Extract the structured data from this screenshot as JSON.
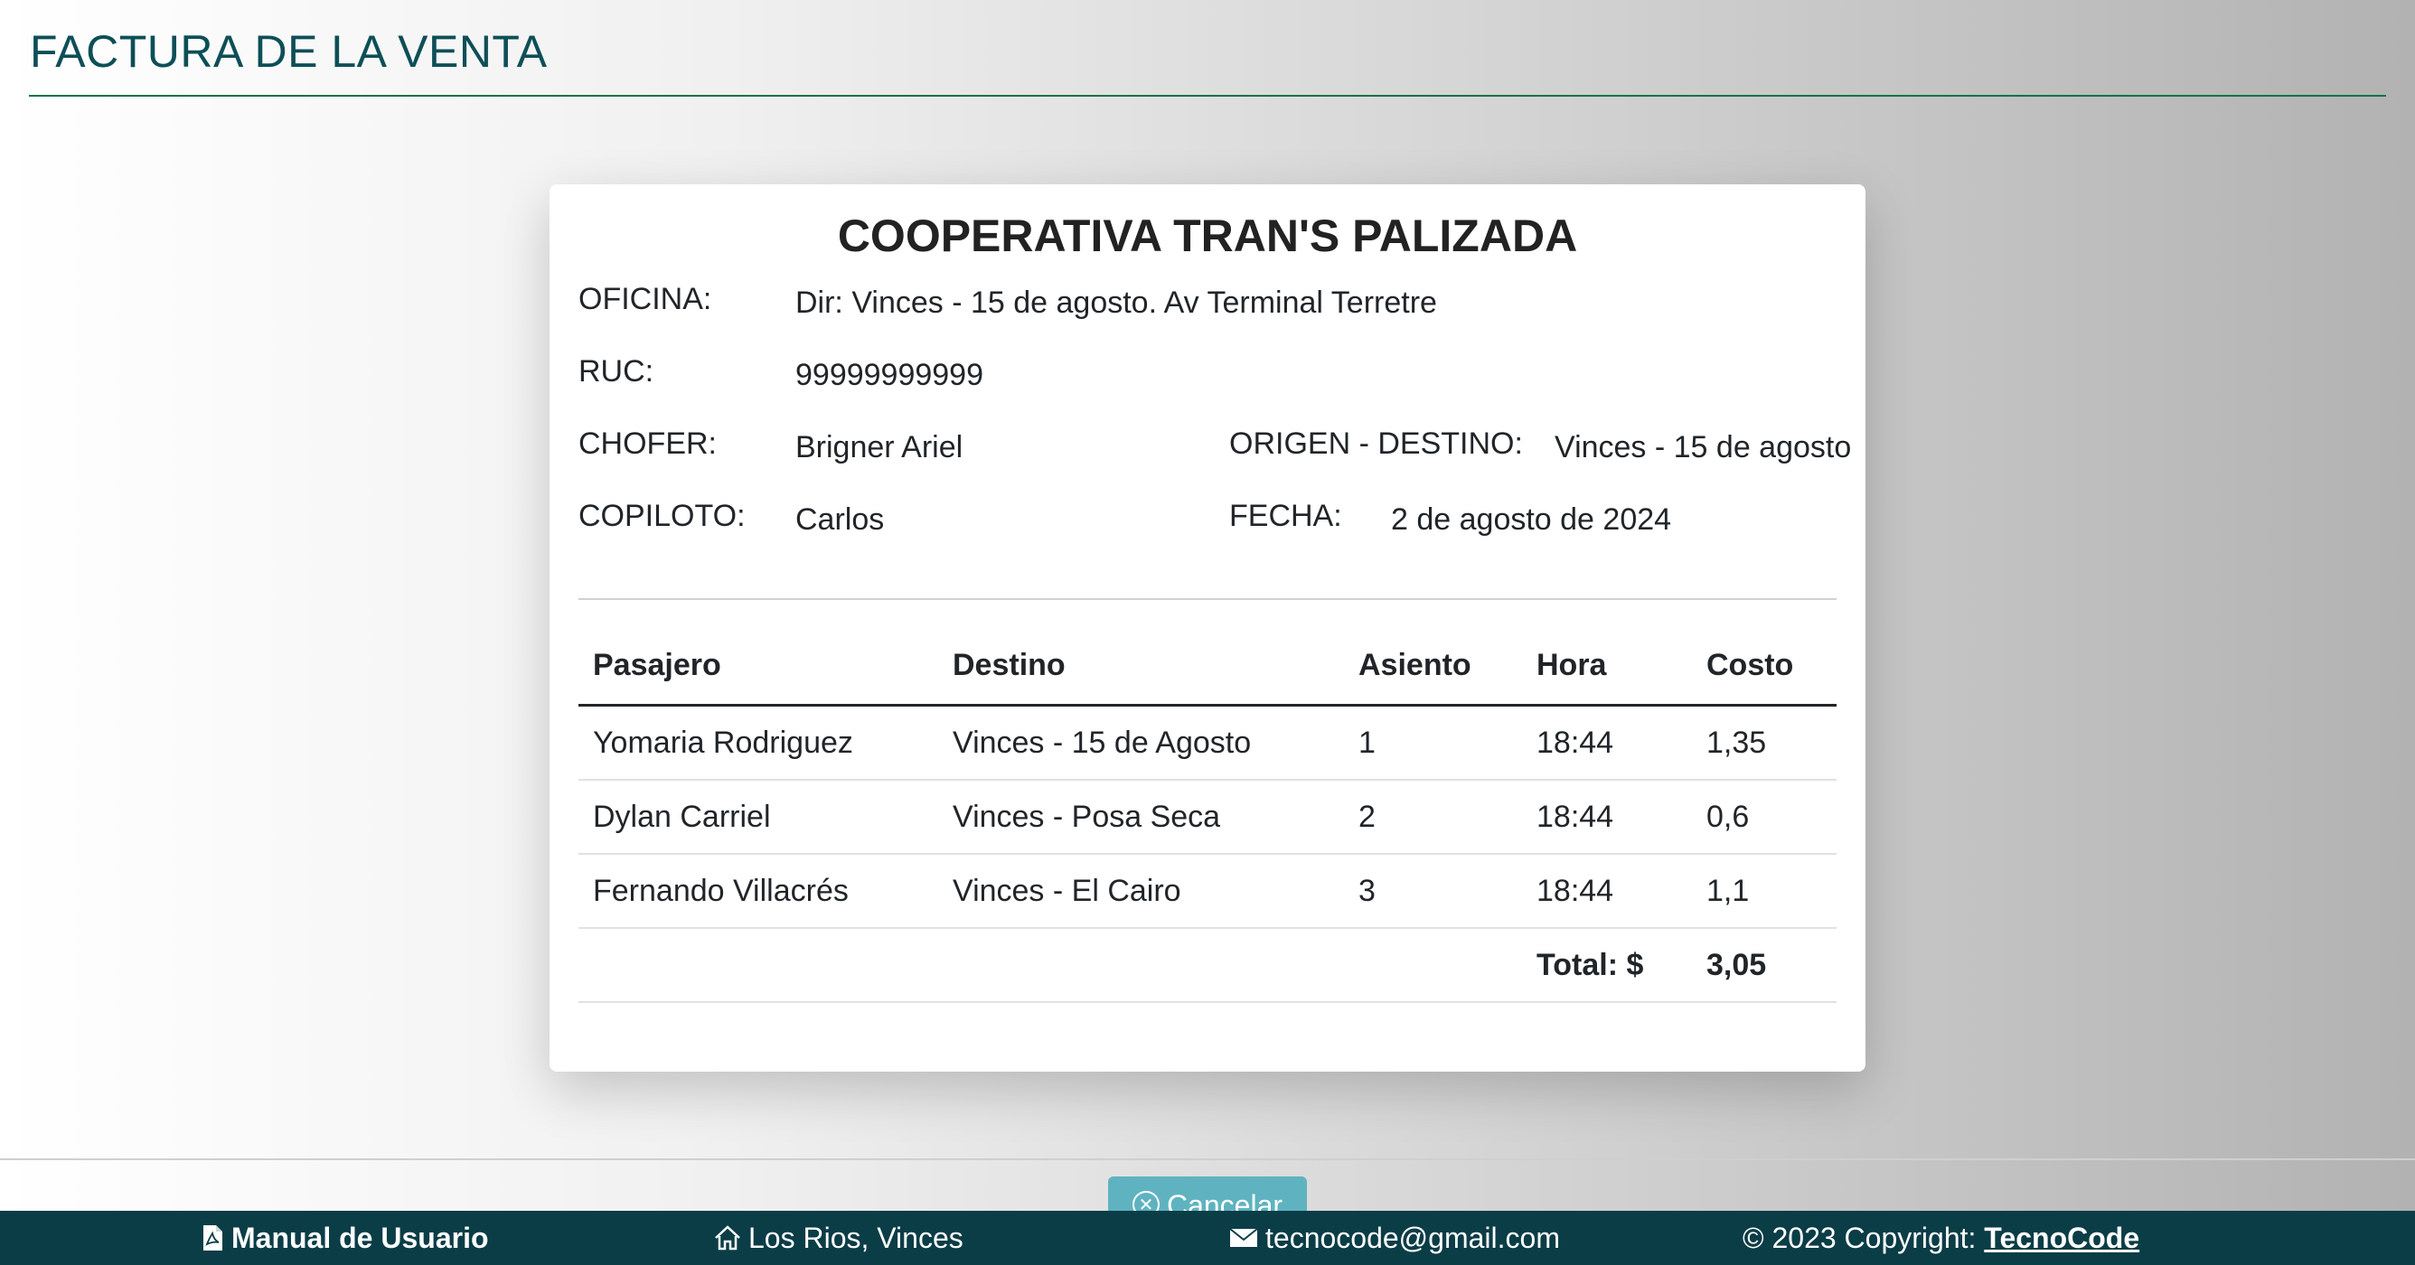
{
  "page": {
    "title": "FACTURA DE LA VENTA"
  },
  "invoice": {
    "company": "COOPERATIVA TRAN'S PALIZADA",
    "oficina_label": "OFICINA:",
    "oficina_value": "Dir: Vinces - 15 de agosto. Av Terminal Terretre",
    "ruc_label": "RUC:",
    "ruc_value": "99999999999",
    "chofer_label": "CHOFER:",
    "chofer_value": "Brigner Ariel",
    "origen_label": "ORIGEN - DESTINO:",
    "origen_value": "Vinces - 15 de agosto",
    "copiloto_label": "COPILOTO:",
    "copiloto_value": "Carlos",
    "fecha_label": "FECHA:",
    "fecha_value": "2 de agosto de 2024"
  },
  "table": {
    "headers": [
      "Pasajero",
      "Destino",
      "Asiento",
      "Hora",
      "Costo"
    ],
    "rows": [
      [
        "Yomaria Rodriguez",
        "Vinces - 15 de Agosto",
        "1",
        "18:44",
        "1,35"
      ],
      [
        "Dylan Carriel",
        "Vinces - Posa Seca",
        "2",
        "18:44",
        "0,6"
      ],
      [
        "Fernando Villacrés",
        "Vinces - El Cairo",
        "3",
        "18:44",
        "1,1"
      ]
    ],
    "total_label": "Total: $",
    "total_value": "3,05"
  },
  "actions": {
    "cancel_label": "Cancelar"
  },
  "footer": {
    "manual": "Manual de Usuario",
    "location": "Los Rios, Vinces",
    "email": "tecnocode@gmail.com",
    "copyright": "© 2023 Copyright:",
    "brand": "TecnoCode"
  },
  "icons": {
    "manual": "file-pdf-icon",
    "location": "home-icon",
    "email": "envelope-icon",
    "cancel": "x-circle-icon"
  },
  "colors": {
    "title": "#0d4f57",
    "rule": "#157347",
    "footer_bg": "#0b3d47",
    "cancel_btn": "#5fb3c0"
  }
}
